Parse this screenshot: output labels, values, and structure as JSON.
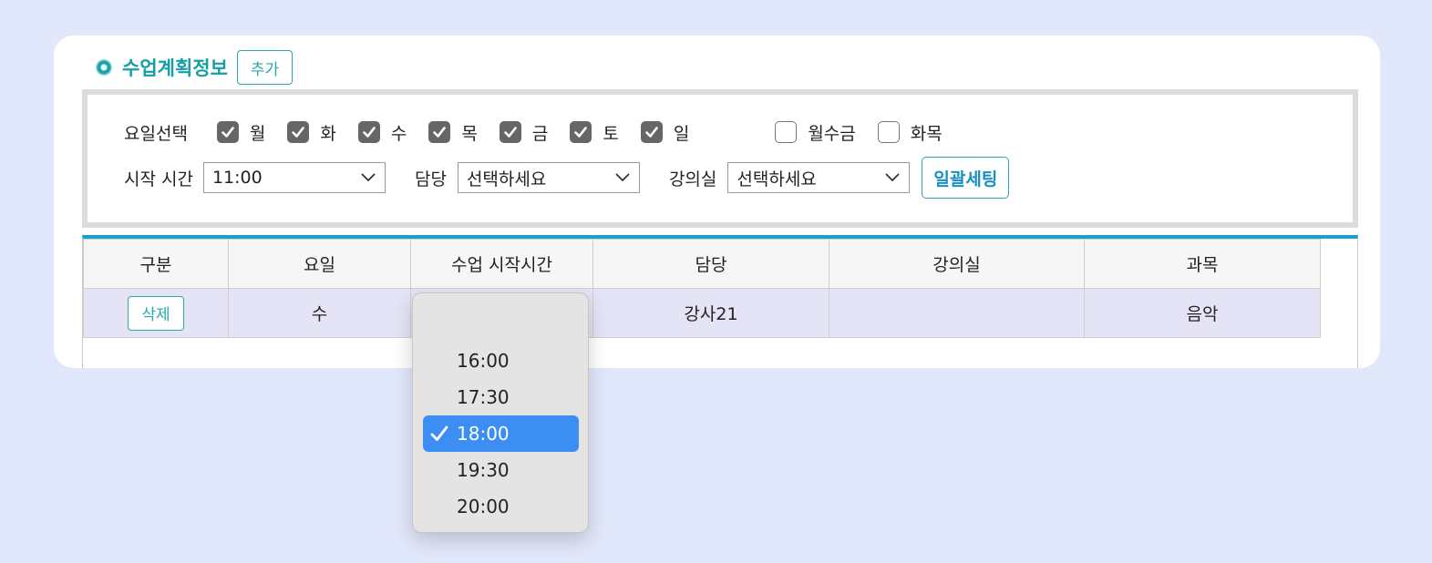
{
  "section": {
    "title": "수업계획정보",
    "add_label": "추가"
  },
  "filters": {
    "day_label": "요일선택",
    "days": [
      {
        "label": "월",
        "checked": true
      },
      {
        "label": "화",
        "checked": true
      },
      {
        "label": "수",
        "checked": true
      },
      {
        "label": "목",
        "checked": true
      },
      {
        "label": "금",
        "checked": true
      },
      {
        "label": "토",
        "checked": true
      },
      {
        "label": "일",
        "checked": true
      }
    ],
    "groups": [
      {
        "label": "월수금",
        "checked": false
      },
      {
        "label": "화목",
        "checked": false
      }
    ],
    "start_time_label": "시작 시간",
    "start_time_value": "11:00",
    "teacher_label": "담당",
    "teacher_value": "선택하세요",
    "room_label": "강의실",
    "room_value": "선택하세요",
    "bulk_label": "일괄세팅"
  },
  "table": {
    "headers": [
      "구분",
      "요일",
      "수업 시작시간",
      "담당",
      "강의실",
      "과목"
    ],
    "row": {
      "delete_label": "삭제",
      "day": "수",
      "teacher": "강사21",
      "room": "",
      "subject": "음악"
    }
  },
  "dropdown": {
    "options": [
      "16:00",
      "17:30",
      "18:00",
      "19:30",
      "20:00"
    ],
    "selected": "18:00"
  },
  "colors": {
    "accent": "#16a0a6",
    "table_top": "#1c9fc8",
    "selected_option": "#3d8ef3"
  }
}
